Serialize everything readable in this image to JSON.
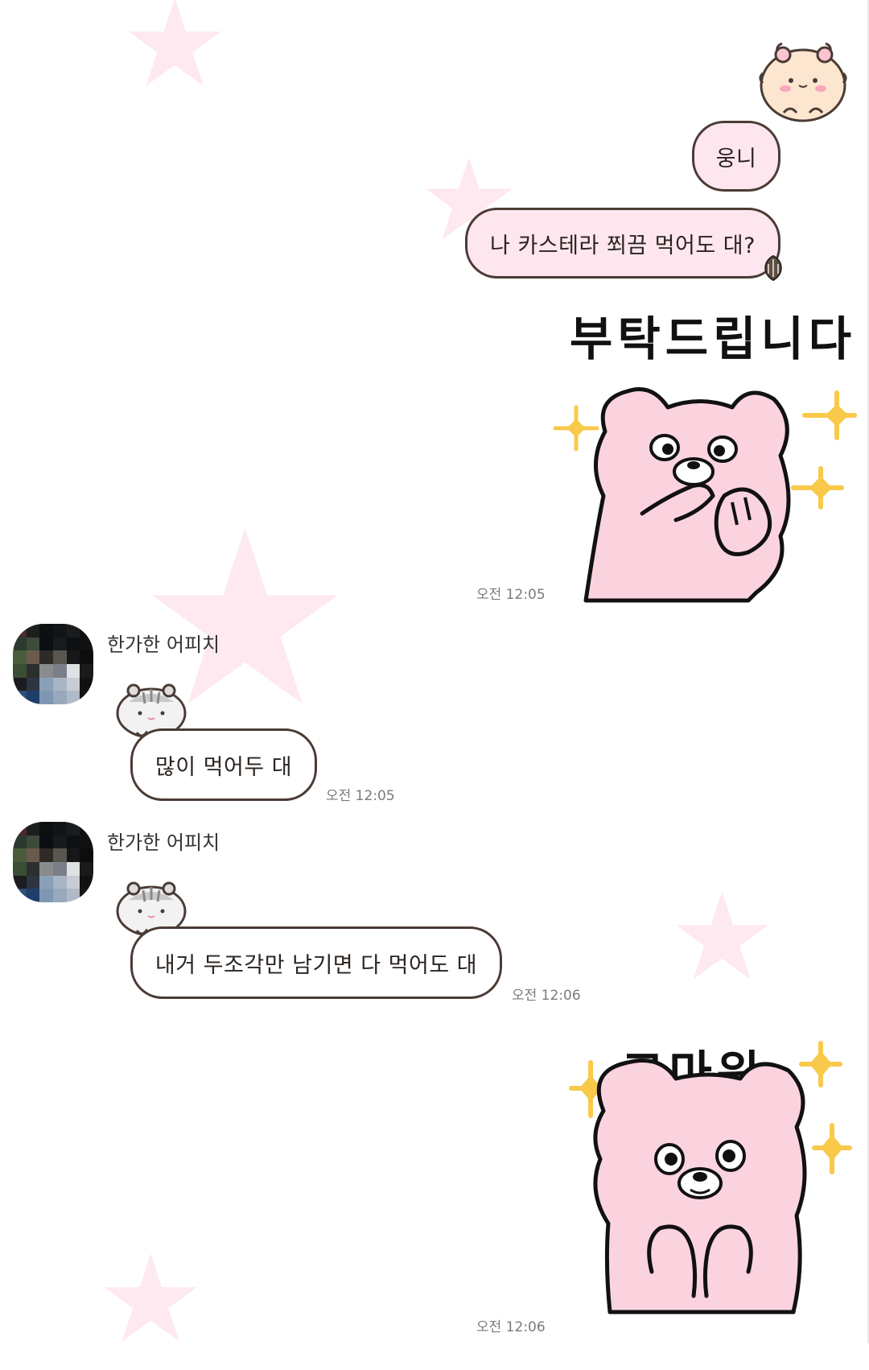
{
  "chat": {
    "messages": {
      "m1": {
        "text": "웅니"
      },
      "m2": {
        "text": "나 카스테라 쬐끔 먹어도 대?"
      },
      "sticker1": {
        "caption": "부탁드립니다",
        "time": "오전 12:05"
      },
      "m3": {
        "sender": "한가한 어피치",
        "text": "많이 먹어두 대",
        "time": "오전 12:05"
      },
      "m4": {
        "sender": "한가한 어피치",
        "text": "내거 두조각만 남기면 다 먹어도 대",
        "time": "오전 12:06"
      },
      "sticker2": {
        "caption": "고마워",
        "time": "오전 12:06"
      }
    }
  },
  "colors": {
    "my_bubble": "#fde6ee",
    "other_bubble": "#ffffff",
    "bubble_border": "#4a3b35",
    "bear_pink": "#fbd3de",
    "sparkle": "#f8c94a",
    "background_star": "#fde9ef"
  },
  "icons": [
    "hamster-icon",
    "gray-hamster-icon",
    "seed-icon",
    "pink-bear-sticker",
    "sparkle-icon"
  ]
}
